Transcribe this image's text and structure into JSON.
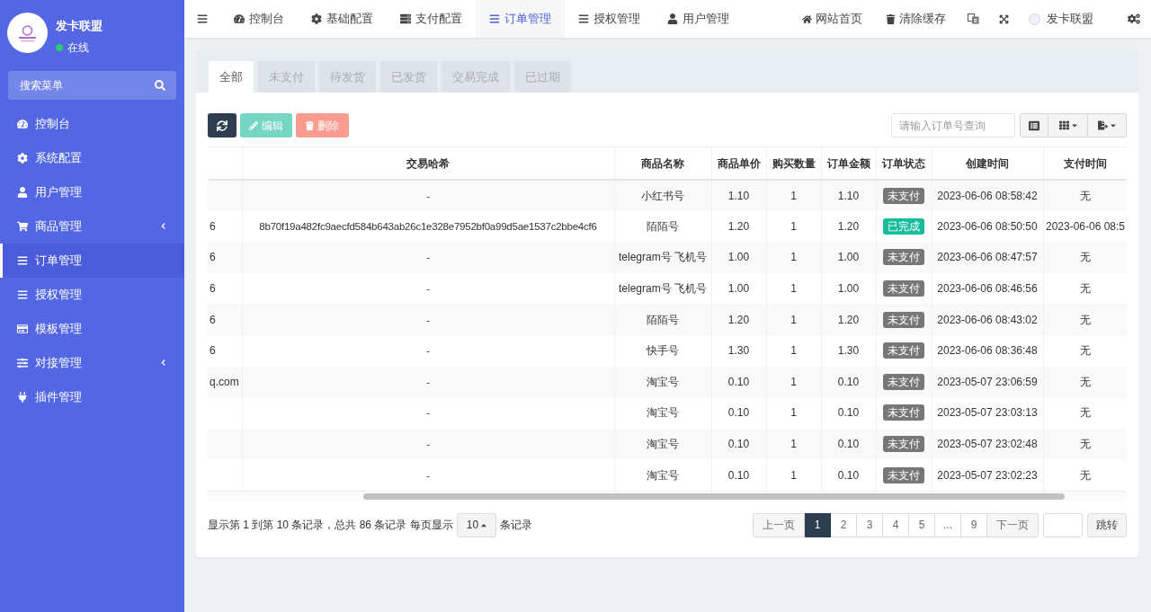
{
  "sidebar": {
    "user": {
      "name": "发卡联盟",
      "status": "在线"
    },
    "search": {
      "placeholder": "搜索菜单"
    },
    "items": [
      {
        "label": "控制台",
        "selected": false,
        "submenu": false
      },
      {
        "label": "系统配置",
        "selected": false,
        "submenu": false
      },
      {
        "label": "用户管理",
        "selected": false,
        "submenu": false
      },
      {
        "label": "商品管理",
        "selected": false,
        "submenu": true
      },
      {
        "label": "订单管理",
        "selected": true,
        "submenu": false
      },
      {
        "label": "授权管理",
        "selected": false,
        "submenu": false
      },
      {
        "label": "模板管理",
        "selected": false,
        "submenu": false
      },
      {
        "label": "对接管理",
        "selected": false,
        "submenu": true
      },
      {
        "label": "插件管理",
        "selected": false,
        "submenu": false
      }
    ]
  },
  "top_nav": {
    "items": [
      {
        "label": "控制台",
        "selected": false
      },
      {
        "label": "基础配置",
        "selected": false
      },
      {
        "label": "支付配置",
        "selected": false
      },
      {
        "label": "订单管理",
        "selected": true
      },
      {
        "label": "授权管理",
        "selected": false
      },
      {
        "label": "用户管理",
        "selected": false
      }
    ],
    "right_items": [
      {
        "label": "网站首页"
      },
      {
        "label": "清除缓存"
      }
    ],
    "account": "发卡联盟"
  },
  "order_tabs": [
    {
      "label": "全部",
      "selected": true
    },
    {
      "label": "未支付",
      "selected": false
    },
    {
      "label": "待发货",
      "selected": false
    },
    {
      "label": "已发货",
      "selected": false
    },
    {
      "label": "交易完成",
      "selected": false
    },
    {
      "label": "已过期",
      "selected": false
    }
  ],
  "toolbar": {
    "buttons": [
      {
        "kind": "refresh",
        "disabled": false
      },
      {
        "kind": "edit",
        "label": "编辑",
        "disabled": true
      },
      {
        "kind": "delete",
        "label": "删除",
        "disabled": true
      }
    ],
    "search": {
      "placeholder": "请输入订单号查询"
    }
  },
  "table": {
    "columns": [
      "交易哈希",
      "商品名称",
      "商品单价",
      "购买数量",
      "订单金额",
      "订单状态",
      "创建时间",
      "支付时间"
    ],
    "rows": [
      {
        "hash": "-",
        "product": "小红书号",
        "unit_price": "1.10",
        "quantity": "1",
        "amount": "1.10",
        "status": {
          "label": "未支付",
          "kind": "unpaid"
        },
        "created_at": "2023-06-06 08:58:42",
        "paid_at": "无"
      },
      {
        "column_1": "6",
        "hash": "8b70f19a482fc9aecfd584b643ab26c1e328e7952bf0a99d5ae1537c2bbe4cf6",
        "product": "陌陌号",
        "unit_price": "1.20",
        "quantity": "1",
        "amount": "1.20",
        "status": {
          "label": "已完成",
          "kind": "completed"
        },
        "created_at": "2023-06-06 08:50:50",
        "paid_at": "2023-06-06 08:5"
      },
      {
        "column_1": "6",
        "hash": "-",
        "product": "telegram号 飞机号",
        "unit_price": "1.00",
        "quantity": "1",
        "amount": "1.00",
        "status": {
          "label": "未支付",
          "kind": "unpaid"
        },
        "created_at": "2023-06-06 08:47:57",
        "paid_at": "无"
      },
      {
        "column_1": "6",
        "hash": "-",
        "product": "telegram号 飞机号",
        "unit_price": "1.00",
        "quantity": "1",
        "amount": "1.00",
        "status": {
          "label": "未支付",
          "kind": "unpaid"
        },
        "created_at": "2023-06-06 08:46:56",
        "paid_at": "无"
      },
      {
        "column_1": "6",
        "hash": "-",
        "product": "陌陌号",
        "unit_price": "1.20",
        "quantity": "1",
        "amount": "1.20",
        "status": {
          "label": "未支付",
          "kind": "unpaid"
        },
        "created_at": "2023-06-06 08:43:02",
        "paid_at": "无"
      },
      {
        "column_1": "6",
        "hash": "-",
        "product": "快手号",
        "unit_price": "1.30",
        "quantity": "1",
        "amount": "1.30",
        "status": {
          "label": "未支付",
          "kind": "unpaid"
        },
        "created_at": "2023-06-06 08:36:48",
        "paid_at": "无"
      },
      {
        "column_1": "q.com",
        "hash": "-",
        "product": "淘宝号",
        "unit_price": "0.10",
        "quantity": "1",
        "amount": "0.10",
        "status": {
          "label": "未支付",
          "kind": "unpaid"
        },
        "created_at": "2023-05-07 23:06:59",
        "paid_at": "无"
      },
      {
        "hash": "-",
        "product": "淘宝号",
        "unit_price": "0.10",
        "quantity": "1",
        "amount": "0.10",
        "status": {
          "label": "未支付",
          "kind": "unpaid"
        },
        "created_at": "2023-05-07 23:03:13",
        "paid_at": "无"
      },
      {
        "hash": "-",
        "product": "淘宝号",
        "unit_price": "0.10",
        "quantity": "1",
        "amount": "0.10",
        "status": {
          "label": "未支付",
          "kind": "unpaid"
        },
        "created_at": "2023-05-07 23:02:48",
        "paid_at": "无"
      },
      {
        "hash": "-",
        "product": "淘宝号",
        "unit_price": "0.10",
        "quantity": "1",
        "amount": "0.10",
        "status": {
          "label": "未支付",
          "kind": "unpaid"
        },
        "created_at": "2023-05-07 23:02:23",
        "paid_at": "无"
      }
    ]
  },
  "footer": {
    "summary": "显示第 1 到第 10 条记录，总共 86 条记录 每页显示",
    "page_size": "10",
    "summary_end": "条记录",
    "pagination": {
      "prev": "上一页",
      "pages": [
        {
          "label": "1",
          "selected": true
        },
        {
          "label": "2",
          "selected": false
        },
        {
          "label": "3",
          "selected": false
        },
        {
          "label": "4",
          "selected": false
        },
        {
          "label": "5",
          "selected": false
        },
        {
          "label": "...",
          "selected": false
        },
        {
          "label": "9",
          "selected": false
        }
      ],
      "next": "下一页",
      "jump": "跳转"
    }
  }
}
